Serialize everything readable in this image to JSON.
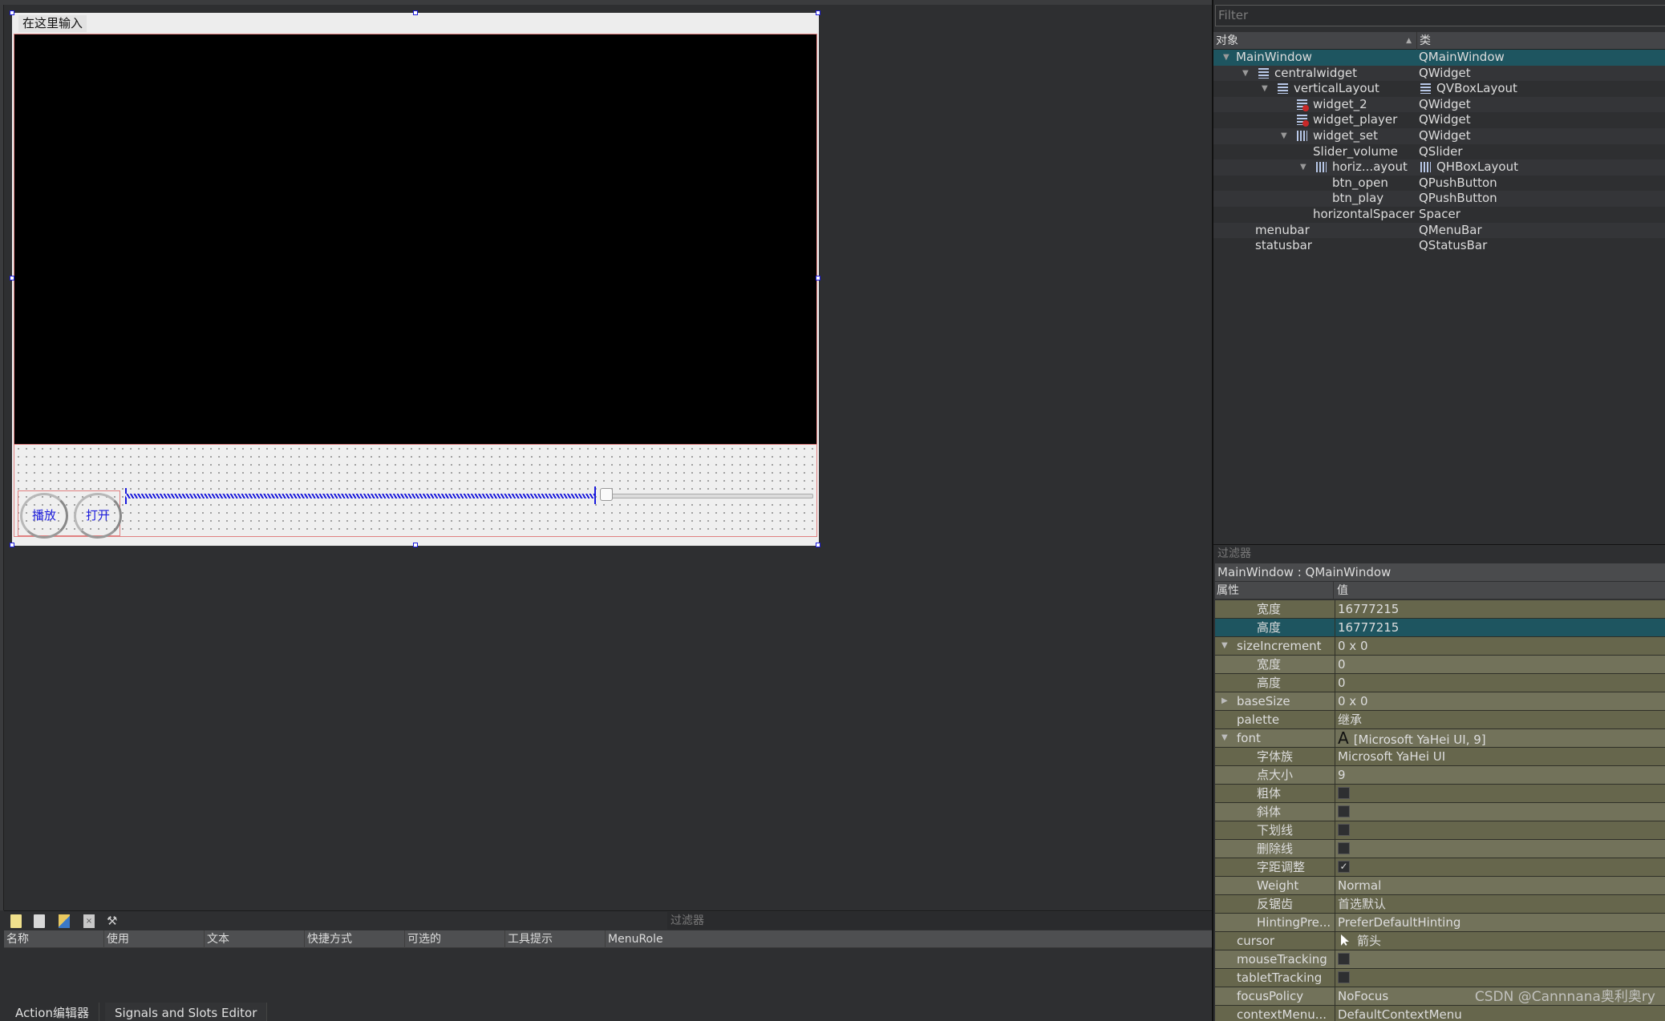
{
  "form": {
    "menubar_placeholder": "在这里输入",
    "buttons": {
      "play": "播放",
      "open": "打开"
    },
    "volume_slider": {
      "value_fraction": 0.68
    }
  },
  "object_inspector": {
    "filter_placeholder": "Filter",
    "columns": {
      "object": "对象",
      "class": "类"
    },
    "tree": [
      {
        "name": "MainWindow",
        "class": "QMainWindow",
        "depth": 0,
        "expanded": true,
        "icon": "none",
        "selected": true
      },
      {
        "name": "centralwidget",
        "class": "QWidget",
        "depth": 1,
        "expanded": true,
        "icon": "vlayout-icon"
      },
      {
        "name": "verticalLayout",
        "class": "QVBoxLayout",
        "depth": 2,
        "expanded": true,
        "icon": "vlayout-icon",
        "class_icon": "vlayout-icon"
      },
      {
        "name": "widget_2",
        "class": "QWidget",
        "depth": 3,
        "icon": "broken-layout-icon"
      },
      {
        "name": "widget_player",
        "class": "QWidget",
        "depth": 3,
        "icon": "broken-layout-icon"
      },
      {
        "name": "widget_set",
        "class": "QWidget",
        "depth": 3,
        "expanded": true,
        "icon": "hlayout-icon"
      },
      {
        "name": "Slider_volume",
        "class": "QSlider",
        "depth": 4,
        "icon": "none"
      },
      {
        "name": "horiz...ayout",
        "class": "QHBoxLayout",
        "depth": 4,
        "expanded": true,
        "icon": "hlayout-icon",
        "class_icon": "hlayout-icon"
      },
      {
        "name": "btn_open",
        "class": "QPushButton",
        "depth": 5,
        "icon": "none"
      },
      {
        "name": "btn_play",
        "class": "QPushButton",
        "depth": 5,
        "icon": "none"
      },
      {
        "name": "horizontalSpacer",
        "class": "Spacer",
        "depth": 4,
        "icon": "none"
      },
      {
        "name": "menubar",
        "class": "QMenuBar",
        "depth": 1,
        "icon": "none"
      },
      {
        "name": "statusbar",
        "class": "QStatusBar",
        "depth": 1,
        "icon": "none"
      }
    ]
  },
  "property_editor": {
    "filter_placeholder": "过滤器",
    "title": "MainWindow : QMainWindow",
    "columns": {
      "property": "属性",
      "value": "值"
    },
    "rows": [
      {
        "name": "宽度",
        "value": "16777215",
        "level": 2
      },
      {
        "name": "高度",
        "value": "16777215",
        "level": 2,
        "selected": true
      },
      {
        "name": "sizeIncrement",
        "value": "0 x 0",
        "level": 1,
        "arrow": "down"
      },
      {
        "name": "宽度",
        "value": "0",
        "level": 2
      },
      {
        "name": "高度",
        "value": "0",
        "level": 2
      },
      {
        "name": "baseSize",
        "value": "0 x 0",
        "level": 1,
        "arrow": "right"
      },
      {
        "name": "palette",
        "value": "继承",
        "level": 1
      },
      {
        "name": "font",
        "value": "[Microsoft YaHei UI, 9]",
        "level": 1,
        "arrow": "down",
        "value_icon": "font-A-icon"
      },
      {
        "name": "字体族",
        "value": "Microsoft YaHei UI",
        "level": 2
      },
      {
        "name": "点大小",
        "value": "9",
        "level": 2
      },
      {
        "name": "粗体",
        "checkbox": false,
        "level": 2
      },
      {
        "name": "斜体",
        "checkbox": false,
        "level": 2
      },
      {
        "name": "下划线",
        "checkbox": false,
        "level": 2
      },
      {
        "name": "删除线",
        "checkbox": false,
        "level": 2
      },
      {
        "name": "字距调整",
        "checkbox": true,
        "level": 2
      },
      {
        "name": "Weight",
        "value": "Normal",
        "level": 2
      },
      {
        "name": "反锯齿",
        "value": "首选默认",
        "level": 2
      },
      {
        "name": "HintingPre...",
        "value": "PreferDefaultHinting",
        "level": 2
      },
      {
        "name": "cursor",
        "value": "箭头",
        "level": 1,
        "value_icon": "arrow-cursor-icon"
      },
      {
        "name": "mouseTracking",
        "checkbox": false,
        "level": 1
      },
      {
        "name": "tabletTracking",
        "checkbox": false,
        "level": 1
      },
      {
        "name": "focusPolicy",
        "value": "NoFocus",
        "level": 1
      },
      {
        "name": "contextMenu...",
        "value": "DefaultContextMenu",
        "level": 1
      }
    ]
  },
  "action_editor": {
    "filter_placeholder": "过滤器",
    "toolbar_icons": [
      "new-action-icon",
      "copy-action-icon",
      "paste-action-icon",
      "delete-action-icon",
      "configure-icon"
    ],
    "columns": [
      "名称",
      "使用",
      "文本",
      "快捷方式",
      "可选的",
      "工具提示",
      "MenuRole"
    ],
    "tabs": [
      "Action编辑器",
      "Signals and Slots Editor"
    ]
  },
  "watermark": "CSDN @Cannnana奥利奥ry"
}
